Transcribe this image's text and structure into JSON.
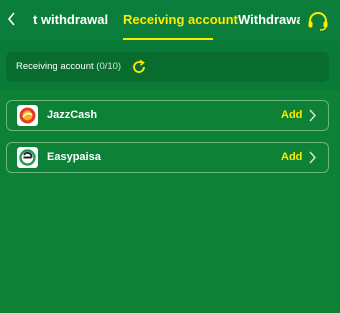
{
  "header": {
    "tabs": [
      {
        "label": "t withdrawal"
      },
      {
        "label": "Receiving account"
      },
      {
        "label": "Withdrawal l"
      }
    ],
    "active_tab": "Receiving account"
  },
  "summary": {
    "label": "Receiving account",
    "count": "(0/10)"
  },
  "accounts": [
    {
      "name": "JazzCash",
      "action": "Add",
      "logo": "jazzcash-logo"
    },
    {
      "name": "Easypaisa",
      "action": "Add",
      "logo": "easypaisa-logo"
    }
  ],
  "colors": {
    "background": "#0a7a38",
    "accent": "#ffea00"
  }
}
